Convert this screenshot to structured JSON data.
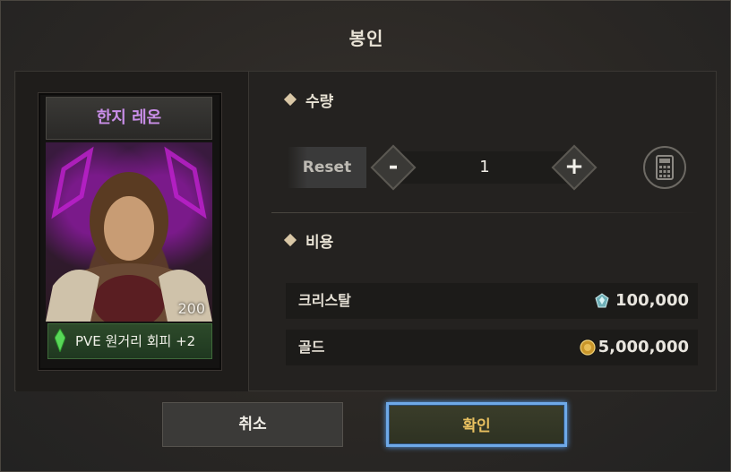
{
  "dialog": {
    "title": "봉인"
  },
  "card": {
    "name": "한지 레온",
    "level": "200",
    "bonus": "PVE 원거리 회피 +2",
    "bonus_icon": "green-gem-icon",
    "name_color": "#c98ee8"
  },
  "quantity": {
    "heading": "수량",
    "reset_label": "Reset",
    "minus_label": "-",
    "plus_label": "+",
    "value": "1",
    "calculator_icon": "calculator-icon"
  },
  "cost": {
    "heading": "비용",
    "items": [
      {
        "label": "크리스탈",
        "icon": "crystal-icon",
        "value": "100,000"
      },
      {
        "label": "골드",
        "icon": "gold-coin-icon",
        "value": "5,000,000"
      }
    ]
  },
  "buttons": {
    "cancel": "취소",
    "confirm": "확인"
  },
  "colors": {
    "confirm_text": "#e8c060",
    "confirm_border": "#6ea9e8",
    "bonus_bg": "#2d4a2a"
  }
}
